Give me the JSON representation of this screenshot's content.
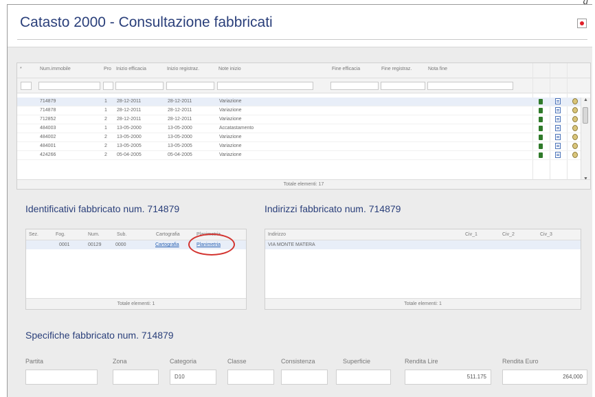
{
  "corner_letter": "g",
  "window": {
    "title": "Catasto 2000 - Consultazione fabbricati"
  },
  "grid": {
    "headers": [
      "*",
      "Num.immobile",
      "Pro",
      "Inizio efficacia",
      "Inizio registraz.",
      "Note inizio",
      "Fine efficacia",
      "Fine registraz.",
      "Nota fine"
    ],
    "rows": [
      [
        "714879",
        "1",
        "28-12-2011",
        "28-12-2011",
        "Variazione"
      ],
      [
        "714878",
        "1",
        "28-12-2011",
        "28-12-2011",
        "Variazione"
      ],
      [
        "712852",
        "2",
        "28-12-2011",
        "28-12-2011",
        "Variazione"
      ],
      [
        "484003",
        "1",
        "13-05-2000",
        "13-05-2000",
        "Accatastamento"
      ],
      [
        "484002",
        "2",
        "13-05-2000",
        "13-05-2000",
        "Variazione"
      ],
      [
        "484001",
        "2",
        "13-05-2005",
        "13-05-2005",
        "Variazione"
      ],
      [
        "424266",
        "2",
        "05-04-2005",
        "05-04-2005",
        "Variazione"
      ]
    ],
    "footer": "Totale elementi: 17"
  },
  "identificativi": {
    "title": "Identificativi fabbricato num. 714879",
    "headers": [
      "Sez.",
      "Fog.",
      "Num.",
      "Sub.",
      "Cartografia",
      "Planimetria"
    ],
    "row": {
      "sez": "",
      "fog": "0001",
      "num": "00129",
      "sub": "0000",
      "cartografia": "Cartografia",
      "planimetria": "Planimetria"
    },
    "footer": "Totale elementi: 1"
  },
  "indirizzi": {
    "title": "Indirizzi fabbricato num. 714879",
    "headers": [
      "Indirizzo",
      "Civ_1",
      "Civ_2",
      "Civ_3"
    ],
    "row": {
      "indirizzo": "VIA MONTE MATERA"
    },
    "footer": "Totale elementi: 1"
  },
  "specifiche": {
    "title": "Specifiche fabbricato  num. 714879",
    "fields": [
      {
        "label": "Partita",
        "value": ""
      },
      {
        "label": "Zona",
        "value": ""
      },
      {
        "label": "Categoria",
        "value": "D10"
      },
      {
        "label": "Classe",
        "value": ""
      },
      {
        "label": "Consistenza",
        "value": ""
      },
      {
        "label": "Superficie",
        "value": ""
      },
      {
        "label": "Rendita Lire",
        "value": "511.175"
      },
      {
        "label": "Rendita Euro",
        "value": "264,000"
      }
    ]
  },
  "colors": {
    "title": "#2a3f7a",
    "link": "#2a62b3",
    "highlight": "#d3332f",
    "close_dot": "#e0202a"
  },
  "icons": [
    "document-green-icon",
    "sheet-list-icon",
    "magnify-detail-icon",
    "close-icon"
  ]
}
